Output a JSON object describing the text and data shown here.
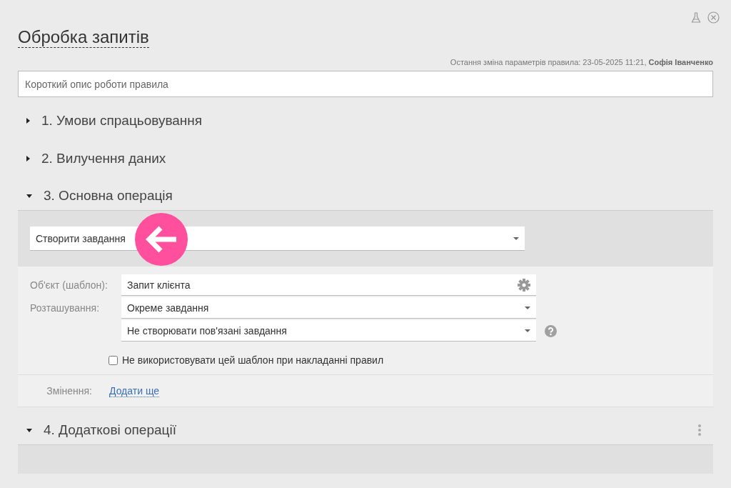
{
  "title": "Обробка запитів",
  "last_change": {
    "prefix": "Остання зміна параметрів правила: 23-05-2025 11:21, ",
    "author": "Софія Іванченко"
  },
  "description": {
    "placeholder": "Короткий опис роботи правила"
  },
  "sections": [
    {
      "title": "1. Умови спрацьовування",
      "expanded": false,
      "menu": false
    },
    {
      "title": "2. Вилучення даних",
      "expanded": false,
      "menu": false
    },
    {
      "title": "3. Основна операція",
      "expanded": true,
      "menu": false,
      "kind": "operation"
    },
    {
      "title": "4. Додаткові операції",
      "expanded": true,
      "menu": true,
      "kind": "empty"
    }
  ],
  "operation": {
    "value": "Створити завдання",
    "fields": [
      {
        "label": "Об'єкт (шаблон):",
        "value": "Запит клієнта",
        "kind": "settings"
      },
      {
        "label": "Розташування:",
        "value": "Окреме завдання",
        "kind": "dropdown"
      },
      {
        "value": "Не створювати пов'язані завдання",
        "kind": "dropdown-help"
      }
    ],
    "checkbox": {
      "label": "Не використовувати цей шаблон при накладанні правил",
      "checked": false
    },
    "changes_label": "Змінення:",
    "add_link": "Додати ще"
  }
}
